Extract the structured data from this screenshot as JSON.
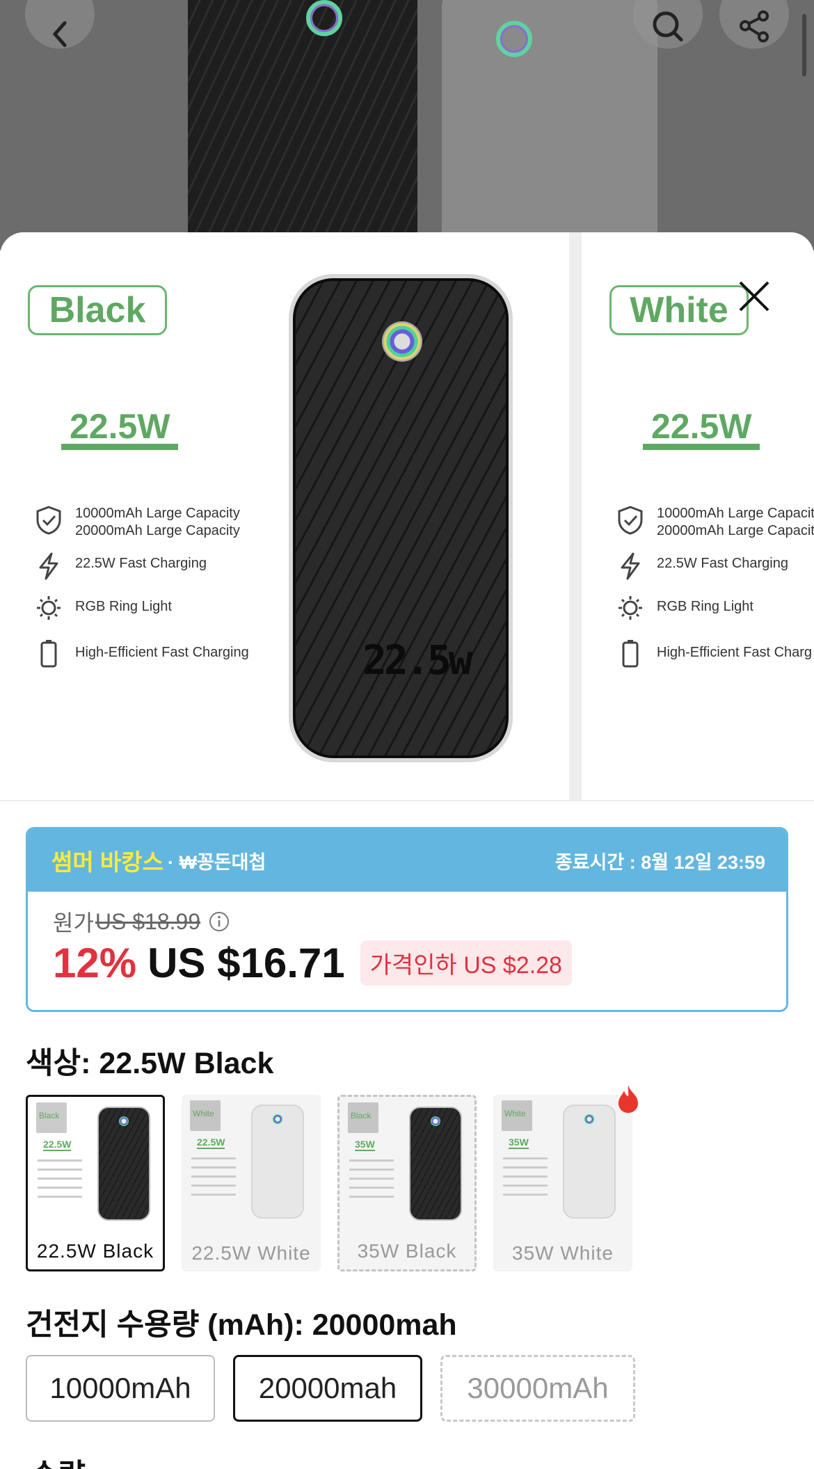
{
  "hero": {
    "back_icon": "chevron-left-icon",
    "search_icon": "search-icon",
    "share_icon": "share-icon"
  },
  "carousel": {
    "slide1": {
      "color_tag": "Black",
      "watt": "22.5W",
      "features": [
        "10000mAh Large Capacity",
        "20000mAh Large Capacity",
        "22.5W Fast Charging",
        "RGB Ring Light",
        "High-Efficient Fast Charging"
      ],
      "screen": "22.5w"
    },
    "slide2": {
      "color_tag": "White",
      "watt": "22.5W",
      "features": [
        "10000mAh Large Capacit",
        "20000mAh Large Capacit",
        "22.5W Fast Charging",
        "RGB Ring Light",
        "High-Efficient Fast Charg"
      ]
    }
  },
  "promo": {
    "event": "썸머 바캉스",
    "event_sub": "· ₩꽁돈대첩",
    "end_time": "종료시간 : 8월 12일 23:59",
    "orig_label": "원가",
    "orig_price": "US $18.99",
    "discount": "12%",
    "price": "US $16.71",
    "cut_badge": "가격인하 US $2.28"
  },
  "color_section": {
    "title": "색상: 22.5W Black",
    "swatches": [
      {
        "label": "22.5W Black",
        "tag": "Black",
        "watt": "22.5W",
        "state": "selected"
      },
      {
        "label": "22.5W White",
        "tag": "White",
        "watt": "22.5W",
        "state": "normal"
      },
      {
        "label": "35W Black",
        "tag": "Black",
        "watt": "35W",
        "state": "unavailable"
      },
      {
        "label": "35W White",
        "tag": "White",
        "watt": "35W",
        "state": "normal"
      }
    ]
  },
  "capacity_section": {
    "title": "건전지 수용량 (mAh): 20000mah",
    "options": [
      {
        "label": "10000mAh",
        "state": "normal"
      },
      {
        "label": "20000mah",
        "state": "selected"
      },
      {
        "label": "30000mAh",
        "state": "unavailable"
      }
    ]
  },
  "next_section": {
    "title": "수량"
  },
  "colors": {
    "accent_green": "#5fa863",
    "promo_blue": "#63b6df",
    "price_red": "#e2313f",
    "event_yellow": "#ffeb3b"
  }
}
